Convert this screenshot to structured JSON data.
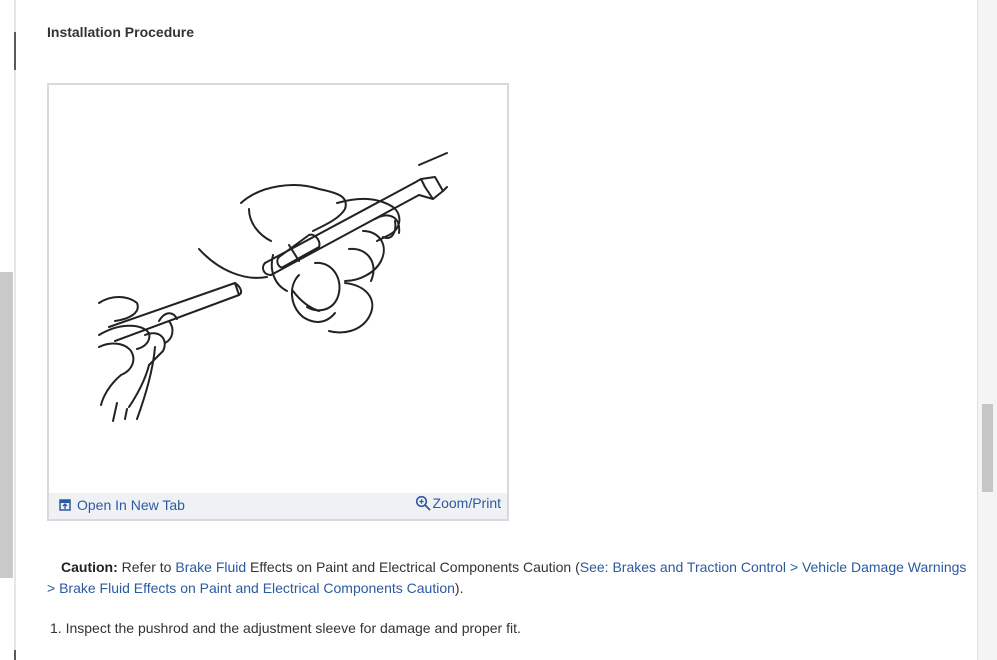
{
  "section": {
    "title": "Installation Procedure"
  },
  "figure": {
    "open_tab_label": "Open In New Tab",
    "zoom_print_label": "Zoom/Print",
    "open_tab_icon": "open-new-tab-icon",
    "zoom_icon": "zoom-in-icon"
  },
  "caution": {
    "label": "Caution:",
    "text_before": "Refer to ",
    "link_text": "Brake Fluid",
    "text_middle": " Effects on Paint and Electrical Components Caution (",
    "see_link": "See: Brakes and Traction Control > Vehicle Damage Warnings > Brake Fluid Effects on Paint and Electrical Components Caution",
    "text_end": ")."
  },
  "steps": [
    {
      "number": "1.",
      "text": "Inspect the pushrod and the adjustment sleeve for damage and proper fit."
    }
  ],
  "colors": {
    "link": "#2c5aa0",
    "toolbar_bg": "#f0f1f4",
    "figure_border": "#d9d9d9"
  }
}
